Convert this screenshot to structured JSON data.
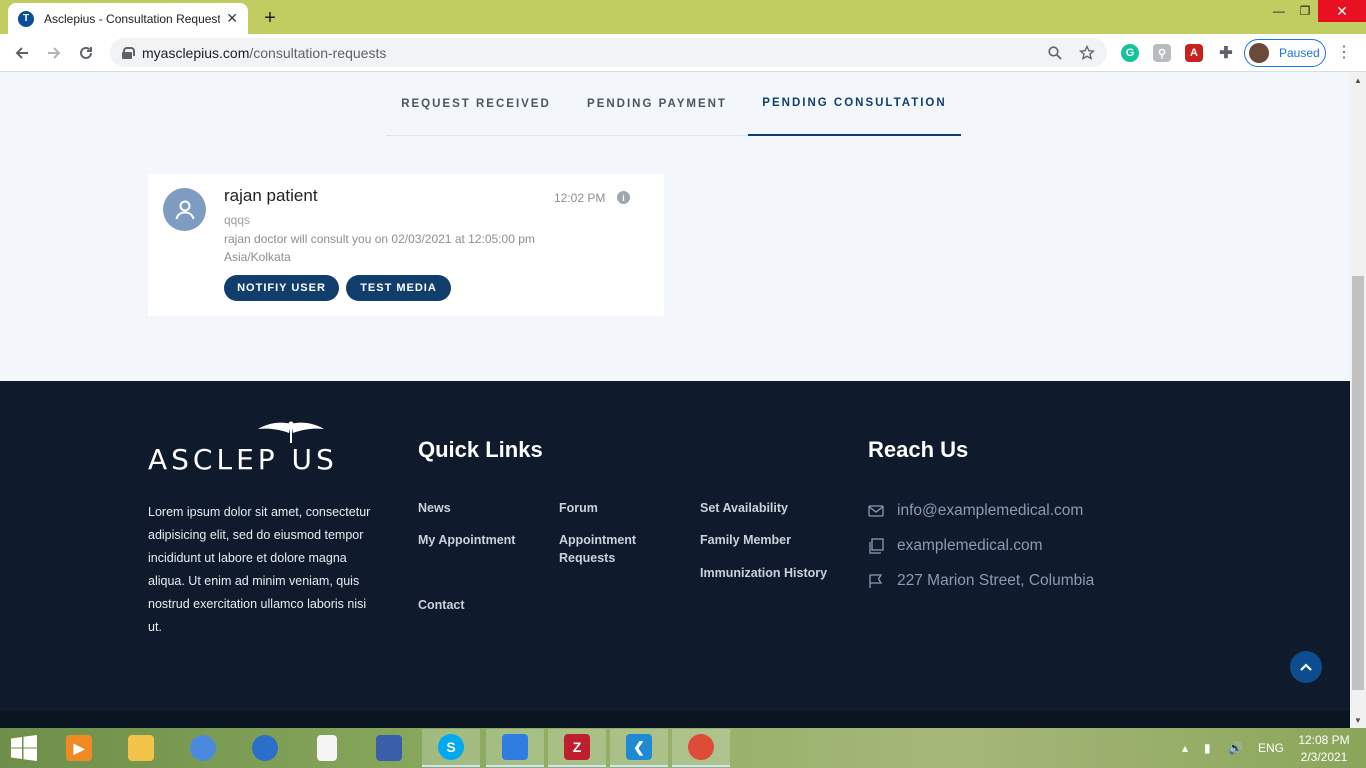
{
  "browser": {
    "tab_title": "Asclepius - Consultation Request",
    "tab_close": "✕",
    "new_tab": "+",
    "url_host": "myasclepius.com",
    "url_path": "/consultation-requests",
    "profile_status": "Paused",
    "window_min": "—",
    "window_max": "❐",
    "window_close": "✕"
  },
  "tabs": [
    {
      "label": "REQUEST RECEIVED",
      "active": false
    },
    {
      "label": "PENDING PAYMENT",
      "active": false
    },
    {
      "label": "PENDING CONSULTATION",
      "active": true
    }
  ],
  "request_card": {
    "name": "rajan patient",
    "time": "12:02 PM",
    "subject": "qqqs",
    "description": "rajan doctor will consult you on 02/03/2021 at 12:05:00 pm Asia/Kolkata",
    "buttons": [
      "NOTIFIY USER",
      "TEST MEDIA"
    ]
  },
  "footer": {
    "logo_text": "ASCLEP  US",
    "logo_name": "ASCLEPIUS",
    "about": "Lorem ipsum dolor sit amet, consectetur adipisicing elit, sed do eiusmod tempor incididunt ut labore et dolore magna aliqua. Ut enim ad minim veniam, quis nostrud exercitation ullamco laboris nisi ut.",
    "quick_links_title": "Quick Links",
    "quick_links": {
      "col1": [
        "News",
        "My Appointment",
        "Contact"
      ],
      "col2": [
        "Forum",
        "Appointment Requests"
      ],
      "col3": [
        "Set Availability",
        "Family Member",
        "Immunization History"
      ]
    },
    "reach_title": "Reach Us",
    "email": "info@examplemedical.com",
    "website": "examplemedical.com",
    "address": "227 Marion Street, Columbia"
  },
  "taskbar": {
    "lang": "ENG",
    "time": "12:08 PM",
    "date": "2/3/2021",
    "apps": [
      "vlc-icon",
      "file-explorer-icon",
      "chrome-icon",
      "thunderbird-icon",
      "file-icon",
      "network-app-icon",
      "skype-icon",
      "app-icon",
      "filezilla-icon",
      "vscode-icon",
      "chrome-active-icon"
    ]
  },
  "colors": {
    "primary": "#123e6e",
    "footer_bg": "#0f1b2c",
    "page_bg": "#f3f7fb",
    "browser_frame": "#c1cd60"
  }
}
